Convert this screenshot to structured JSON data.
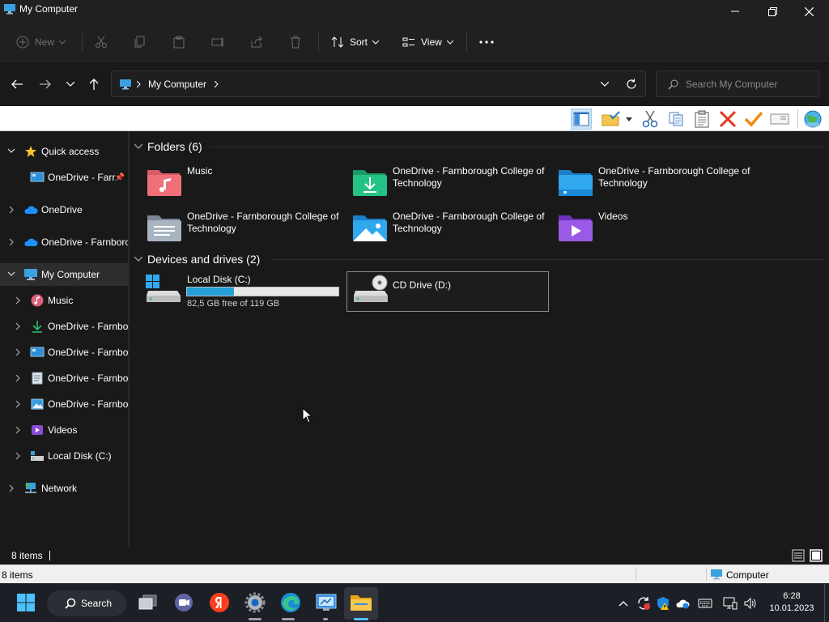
{
  "window": {
    "title": "My Computer"
  },
  "toolbar": {
    "new_label": "New",
    "sort_label": "Sort",
    "view_label": "View"
  },
  "address": {
    "crumb": "My Computer"
  },
  "search": {
    "placeholder": "Search My Computer"
  },
  "nav": {
    "items": [
      {
        "label": "Quick access"
      },
      {
        "label": "OneDrive - Farr"
      },
      {
        "label": "OneDrive"
      },
      {
        "label": "OneDrive - Farnboro"
      },
      {
        "label": "My Computer"
      },
      {
        "label": "Music"
      },
      {
        "label": "OneDrive - Farnbo"
      },
      {
        "label": "OneDrive - Farnbo"
      },
      {
        "label": "OneDrive - Farnbo"
      },
      {
        "label": "OneDrive - Farnbo"
      },
      {
        "label": "Videos"
      },
      {
        "label": "Local Disk (C:)"
      },
      {
        "label": "Network"
      }
    ]
  },
  "content": {
    "folders_header": "Folders (6)",
    "folders": [
      {
        "name": "Music"
      },
      {
        "name": "OneDrive - Farnborough College of Technology"
      },
      {
        "name": "OneDrive - Farnborough College of Technology"
      },
      {
        "name": "OneDrive - Farnborough College of Technology"
      },
      {
        "name": "OneDrive - Farnborough College of Technology"
      },
      {
        "name": "Videos"
      }
    ],
    "devices_header": "Devices and drives (2)",
    "drives": [
      {
        "name": "Local Disk (C:)",
        "free_text": "82,5 GB free of 119 GB",
        "used_fraction": 0.31
      },
      {
        "name": "CD Drive (D:)"
      }
    ]
  },
  "status": {
    "items_count": "8 items",
    "items_count_classic": "8 items",
    "zone": "Computer"
  },
  "taskbar": {
    "search_label": "Search"
  },
  "clock": {
    "time": "6:28",
    "date": "10.01.2023"
  },
  "colors": {
    "accent": "#26a0da",
    "background": "#191919",
    "taskbar": "#1c1f26"
  }
}
